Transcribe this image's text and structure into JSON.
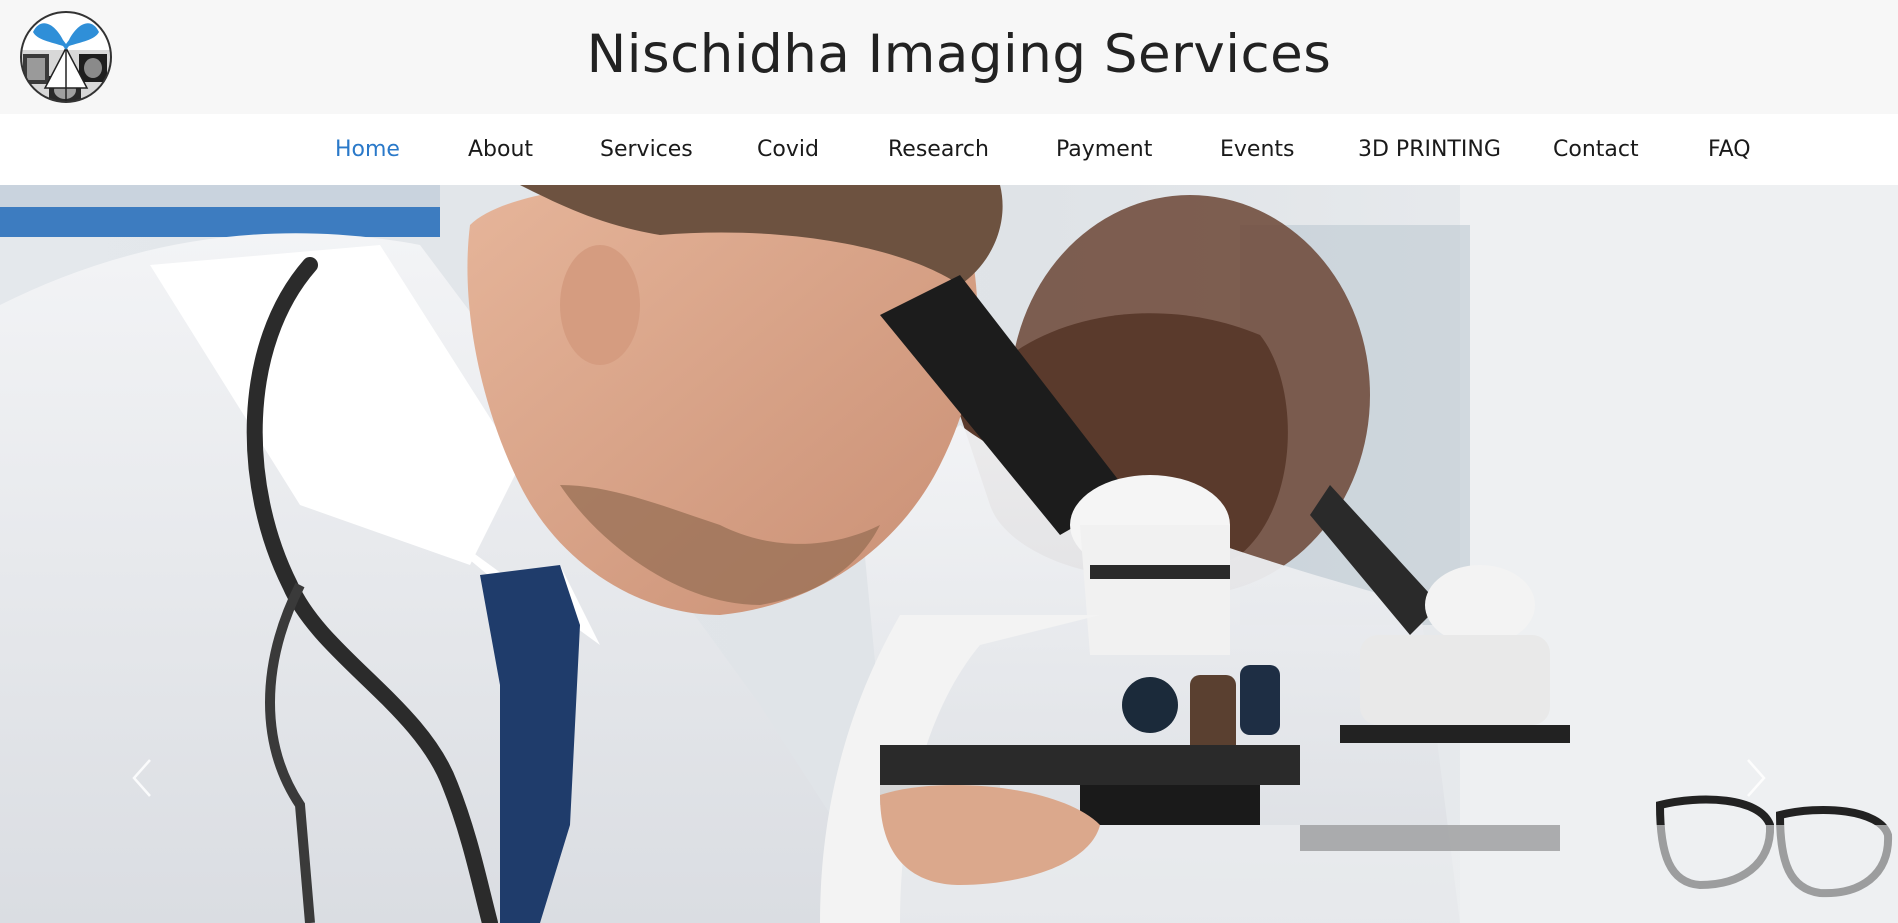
{
  "header": {
    "title": "Nischidha Imaging Services",
    "logo_icon": "nischidha-logo-icon"
  },
  "nav": {
    "items": [
      {
        "label": "Home",
        "active": true
      },
      {
        "label": "About",
        "active": false
      },
      {
        "label": "Services",
        "active": false
      },
      {
        "label": "Covid",
        "active": false
      },
      {
        "label": "Research",
        "active": false
      },
      {
        "label": "Payment",
        "active": false
      },
      {
        "label": "Events",
        "active": false
      },
      {
        "label": "3D PRINTING",
        "active": false
      },
      {
        "label": "Contact",
        "active": false
      },
      {
        "label": "FAQ",
        "active": false
      }
    ]
  },
  "hero": {
    "slide_icon_prev": "chevron-left-icon",
    "slide_icon_next": "chevron-right-icon"
  },
  "colors": {
    "active_link": "#2a79c9",
    "header_bg": "#f7f7f7",
    "title_text": "#222222"
  }
}
